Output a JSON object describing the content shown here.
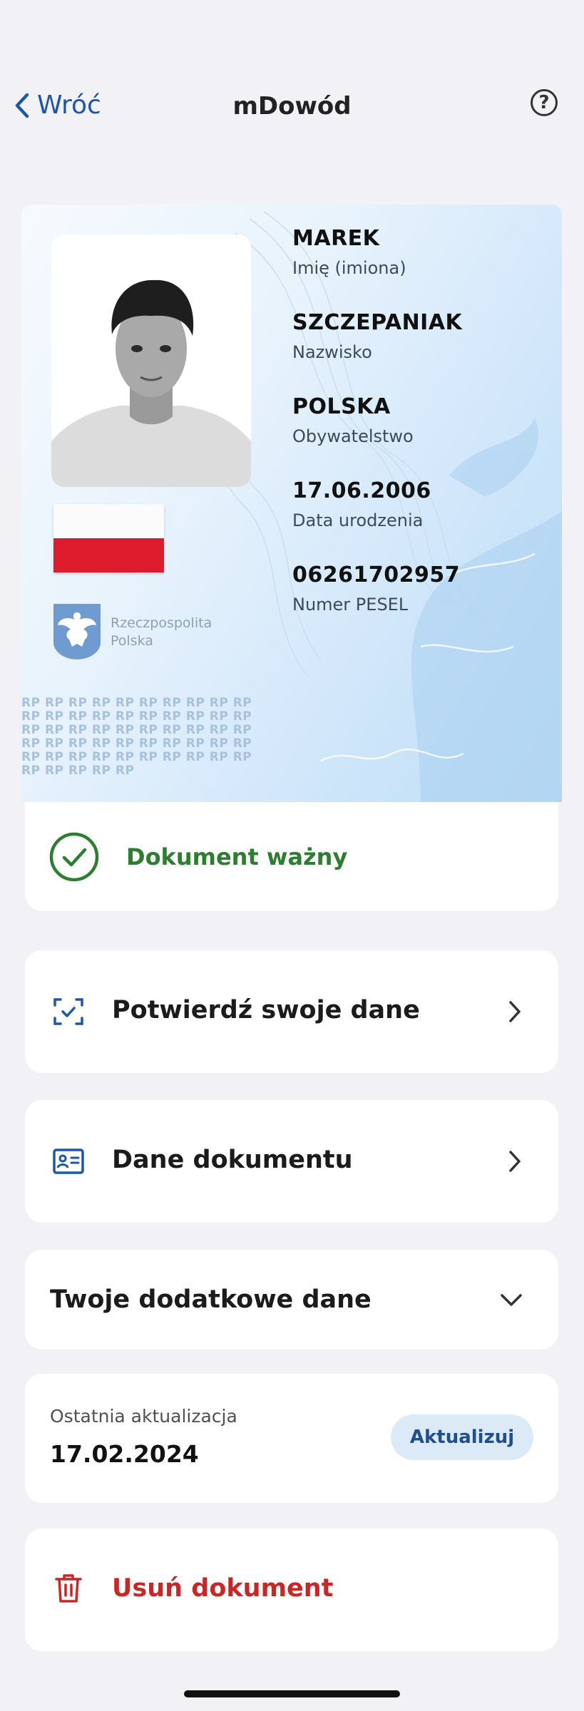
{
  "header": {
    "back_label": "Wróć",
    "title": "mDowód",
    "help_glyph": "?"
  },
  "card": {
    "first_name": {
      "value": "MAREK",
      "label": "Imię (imiona)"
    },
    "last_name": {
      "value": "SZCZEPANIAK",
      "label": "Nazwisko"
    },
    "citizenship": {
      "value": "POLSKA",
      "label": "Obywatelstwo"
    },
    "birth_date": {
      "value": "17.06.2006",
      "label": "Data urodzenia"
    },
    "pesel": {
      "value": "06261702957",
      "label": "Numer PESEL"
    },
    "emblem_line1": "Rzeczpospolita",
    "emblem_line2": "Polska",
    "pattern_text": "RP RP RP RP RP RP RP RP RP RP RP RP RP RP RP RP RP RP RP RP RP RP RP RP RP RP RP RP RP RP RP RP RP RP RP RP RP RP RP RP RP RP RP RP RP RP RP RP RP RP RP RP RP RP RP"
  },
  "status": {
    "label": "Dokument ważny",
    "color": "#2e7d32",
    "icon": "check-circle-icon"
  },
  "actions": {
    "confirm_label": "Potwierdź swoje dane",
    "document_label": "Dane dokumentu",
    "additional_label": "Twoje dodatkowe dane"
  },
  "update": {
    "label": "Ostatnia aktualizacja",
    "date": "17.02.2024",
    "button_label": "Aktualizuj"
  },
  "delete": {
    "label": "Usuń dokument",
    "color": "#c62828"
  },
  "colors": {
    "accent": "#1f57a6",
    "flag_red": "#dd1b2c",
    "background": "#f2f2f6"
  }
}
